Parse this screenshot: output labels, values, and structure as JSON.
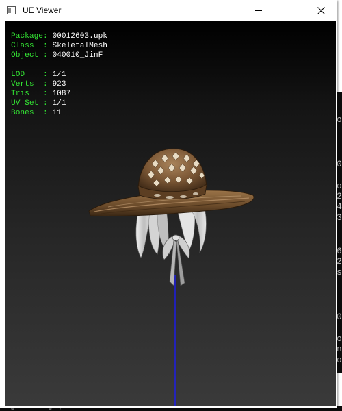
{
  "window": {
    "title": "UE Viewer"
  },
  "info": {
    "package_label": "Package:",
    "package_value": "00012603.upk",
    "class_label": "Class  :",
    "class_value": "SkeletalMesh",
    "object_label": "Object :",
    "object_value": "040010_JinF",
    "lod_label": "LOD    :",
    "lod_value": "1/1",
    "verts_label": "Verts  :",
    "verts_value": "923",
    "tris_label": "Tris   :",
    "tris_value": "1087",
    "uvset_label": "UV Set :",
    "uvset_value": "1/1",
    "bones_label": "Bones  :",
    "bones_value": "11"
  },
  "background_console": {
    "bottom_line": "[D50001] process \"Mirama win 6.0.6.16\" exited with code: 0",
    "right_chars": [
      "o",
      "0",
      "o",
      "2",
      "4",
      "3",
      "6",
      "2",
      "s",
      "0",
      "o",
      "n",
      "o"
    ]
  },
  "colors": {
    "label_green": "#33e233",
    "axis_blue": "#1a1aff"
  }
}
